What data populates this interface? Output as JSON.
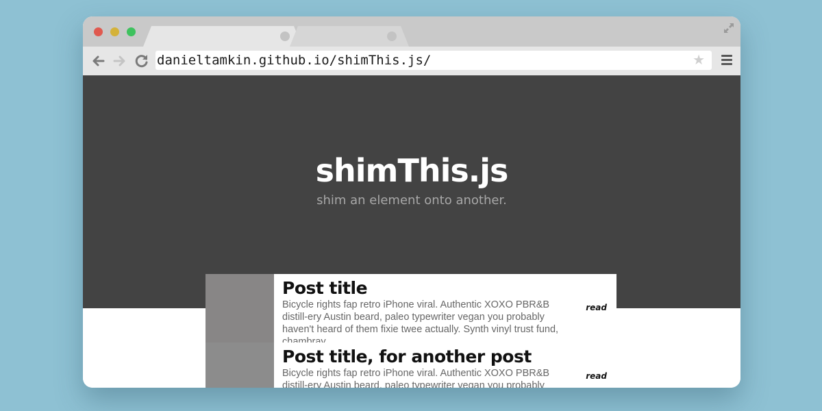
{
  "browser": {
    "url": "danieltamkin.github.io/shimThis.js/",
    "star_glyph": "★",
    "icons": {
      "back": "back-arrow-icon",
      "forward": "forward-arrow-icon",
      "reload": "reload-icon",
      "bookmark": "star-icon",
      "menu": "hamburger-menu-icon",
      "fullscreen": "expand-icon"
    },
    "traffic_lights": {
      "close": "#e0594f",
      "minimize": "#d4b23a",
      "zoom": "#3ec25e"
    }
  },
  "hero": {
    "title": "shimThis.js",
    "subtitle": "shim an element onto another.",
    "background": "#434343"
  },
  "posts": [
    {
      "title": "Post title",
      "body": "Bicycle rights fap retro iPhone viral. Authentic XOXO PBR&B distill-ery Austin beard, paleo typewriter vegan you probably haven't heard of them fixie twee actually. Synth vinyl trust fund, chambray",
      "read_label": "read"
    },
    {
      "title": "Post title, for another post",
      "body": "Bicycle rights fap retro iPhone viral. Authentic XOXO PBR&B distill-ery Austin beard, paleo typewriter vegan you probably haven't heard of them fixie twee actually. Synth vinyl trust fund, chambray",
      "read_label": "read"
    }
  ]
}
